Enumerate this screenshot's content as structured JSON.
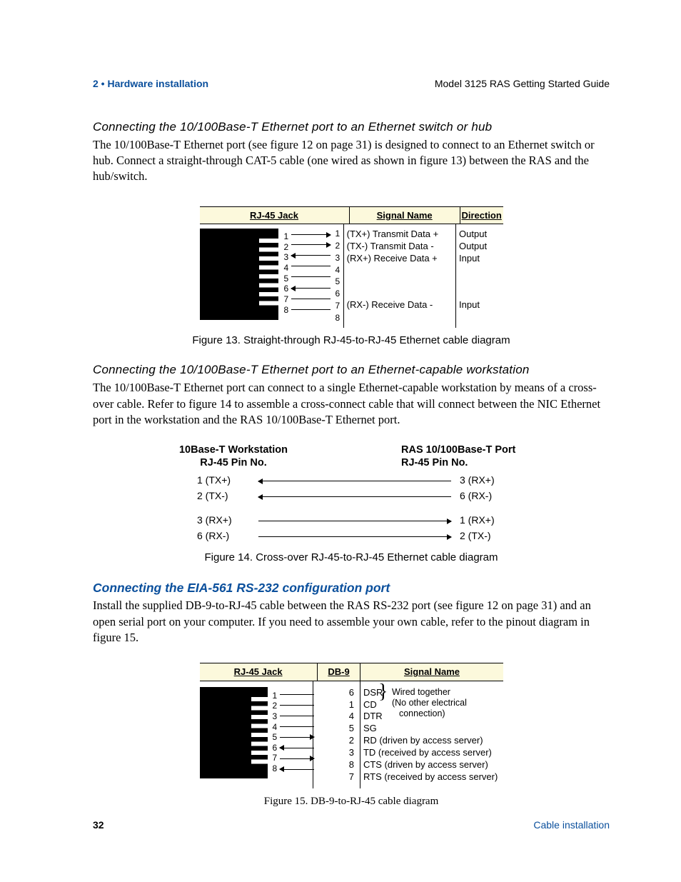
{
  "header": {
    "left": "2 • Hardware installation",
    "right": "Model 3125 RAS Getting Started Guide"
  },
  "sec1": {
    "heading": "Connecting the 10/100Base-T Ethernet port to an Ethernet switch or hub",
    "body": "The 10/100Base-T Ethernet port (see figure 12 on page 31) is designed to connect to an Ethernet switch or hub. Connect a straight-through CAT-5 cable (one wired as shown in figure 13) between the RAS and the hub/switch."
  },
  "fig13": {
    "head_jack": "RJ-45 Jack",
    "head_signal": "Signal Name",
    "head_dir": "Direction",
    "pins_left": [
      "1",
      "2",
      "3",
      "4",
      "5",
      "6",
      "7",
      "8"
    ],
    "pins_right": [
      "1",
      "2",
      "3",
      "4",
      "5",
      "6",
      "7",
      "8"
    ],
    "signals": [
      "(TX+) Transmit Data +",
      "(TX-) Transmit Data -",
      "(RX+) Receive Data +",
      "",
      "",
      "(RX-) Receive Data -",
      "",
      ""
    ],
    "dirs": [
      "Output",
      "Output",
      "Input",
      "",
      "",
      "Input",
      "",
      ""
    ],
    "caption": "Figure 13. Straight-through RJ-45-to-RJ-45 Ethernet cable diagram"
  },
  "sec2": {
    "heading": "Connecting the 10/100Base-T Ethernet port to an Ethernet-capable workstation",
    "body": "The 10/100Base-T Ethernet port can connect to a single Ethernet-capable workstation by means of a cross-over cable. Refer to figure 14 to assemble a cross-connect cable that will connect between the NIC Ethernet port in the workstation and the RAS 10/100Base-T Ethernet port."
  },
  "fig14": {
    "left_head1": "10Base-T Workstation",
    "left_head2": "RJ-45 Pin No.",
    "right_head1": "RAS 10/100Base-T Port",
    "right_head2": "RJ-45 Pin No.",
    "rows": [
      {
        "l": "1  (TX+)",
        "r": "3  (RX+)",
        "arrow": "L"
      },
      {
        "l": "2  (TX-)",
        "r": "6  (RX-)",
        "arrow": "L"
      },
      {
        "gap": true
      },
      {
        "l": "3  (RX+)",
        "r": "1  (RX+)",
        "arrow": "R"
      },
      {
        "l": "6  (RX-)",
        "r": "2  (TX-)",
        "arrow": "R"
      }
    ],
    "caption": "Figure 14. Cross-over RJ-45-to-RJ-45 Ethernet cable diagram"
  },
  "sec3": {
    "heading": "Connecting the EIA-561 RS-232 configuration port",
    "body": "Install the supplied DB-9-to-RJ-45 cable between the RAS RS-232 port (see figure 12 on page 31) and an open serial port on your computer. If you need to assemble your own cable, refer to the pinout diagram in figure 15."
  },
  "fig15": {
    "head_jack": "RJ-45 Jack",
    "head_db9": "DB-9",
    "head_sig": "Signal Name",
    "pins_left": [
      "1",
      "2",
      "3",
      "4",
      "5",
      "6",
      "7",
      "8"
    ],
    "db9": [
      "6",
      "1",
      "4",
      "5",
      "2",
      "3",
      "8",
      "7"
    ],
    "sigs": [
      "DSR",
      "CD",
      "DTR",
      "SG",
      "RD (driven by access server)",
      "TD (received by access server)",
      "CTS (driven by access server)",
      "RTS (received by access server)"
    ],
    "brace_note1": "Wired together",
    "brace_note2": "(No other electrical",
    "brace_note3": "connection)",
    "caption": "Figure 15. DB-9-to-RJ-45 cable diagram"
  },
  "footer": {
    "page": "32",
    "right": "Cable installation"
  }
}
